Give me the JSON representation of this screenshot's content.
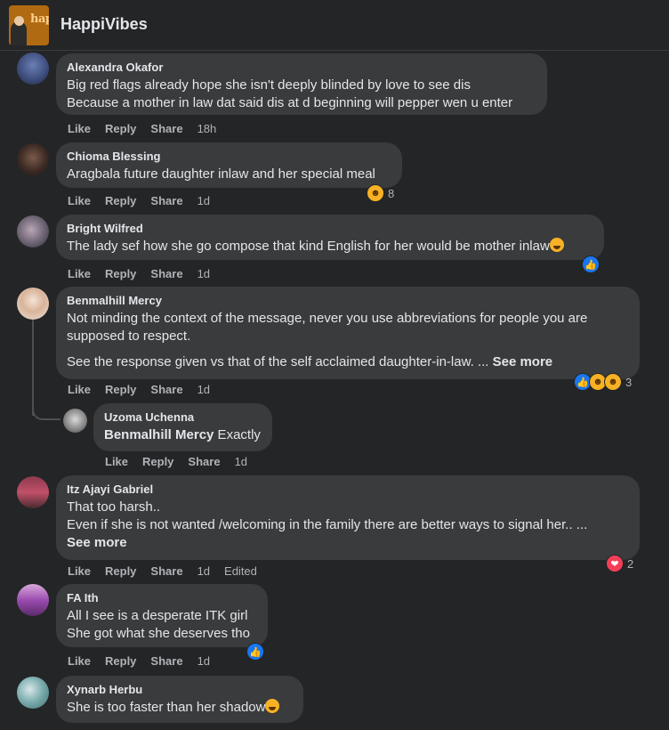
{
  "page": {
    "name": "HappiVibes",
    "logo_text": "hap"
  },
  "colors": {
    "background": "#242526",
    "bubble": "#3a3b3c",
    "text": "#e4e6eb",
    "muted": "#b0b3b8",
    "like_blue": "#1877f2",
    "haha_yellow": "#f7b125",
    "love_red": "#f33e58"
  },
  "comments": [
    {
      "author": "Alexandra Okafor",
      "lines": [
        "Big red flags already hope she isn't deeply blinded by love to see dis",
        "Because a mother in law dat said dis at d beginning will pepper wen u enter"
      ],
      "like": "Like",
      "reply": "Reply",
      "share": "Share",
      "time": "18h"
    },
    {
      "author": "Chioma Blessing",
      "lines": [
        "Aragbala future daughter inlaw and her special meal"
      ],
      "like": "Like",
      "reply": "Reply",
      "share": "Share",
      "time": "1d",
      "reactions": {
        "icons": [
          "haha-icon"
        ],
        "count": "8"
      }
    },
    {
      "author": "Bright Wilfred",
      "lines": [
        "The lady sef how she go compose that kind English for her would be mother inlaw"
      ],
      "like": "Like",
      "reply": "Reply",
      "share": "Share",
      "time": "1d",
      "reactions": {
        "icons": [
          "like-icon"
        ],
        "count": ""
      }
    },
    {
      "author": "Benmalhill Mercy",
      "lines": [
        "Not minding the context of the message, never you use abbreviations for people you are",
        "supposed to respect."
      ],
      "extra": "See the response given vs that of the self acclaimed daughter-in-law. ... ",
      "see_more": "See more",
      "like": "Like",
      "reply": "Reply",
      "share": "Share",
      "time": "1d",
      "reactions": {
        "icons": [
          "like-icon",
          "haha-icon",
          "haha-icon"
        ],
        "count": "3"
      }
    },
    {
      "author": "Uzoma Uchenna",
      "mention": "Benmalhill Mercy",
      "text": " Exactly",
      "like": "Like",
      "reply": "Reply",
      "share": "Share",
      "time": "1d"
    },
    {
      "author": "Itz Ajayi Gabriel",
      "lines": [
        "That too harsh..",
        "Even if she is not wanted /welcoming in the family there are better ways to signal her.. ..."
      ],
      "see_more": "See more",
      "like": "Like",
      "reply": "Reply",
      "share": "Share",
      "time": "1d",
      "edited": "Edited",
      "reactions": {
        "icons": [
          "love-icon"
        ],
        "count": "2"
      }
    },
    {
      "author": "FA Ith",
      "lines": [
        "All I see is a desperate ITK girl",
        "She got what she deserves tho"
      ],
      "like": "Like",
      "reply": "Reply",
      "share": "Share",
      "time": "1d",
      "reactions": {
        "icons": [
          "like-icon"
        ],
        "count": ""
      }
    },
    {
      "author": "Xynarb Herbu",
      "lines": [
        "She is too faster than her shadow"
      ]
    }
  ]
}
